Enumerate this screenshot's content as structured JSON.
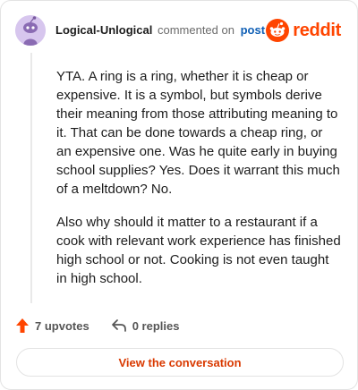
{
  "header": {
    "username": "Logical-Unlogical",
    "verb": "commented on",
    "post_link": "post",
    "brand": "reddit",
    "brand_color": "#ff4500",
    "avatar_icon": "snoo-avatar-icon"
  },
  "comment": {
    "paragraphs": [
      "YTA. A ring is a ring, whether it is cheap or expensive. It is a symbol, but symbols derive their meaning from those attributing meaning to it. That can be done towards a cheap ring, or an expensive one. Was he quite early in buying school supplies? Yes. Does it warrant this much of a meltdown? No.",
      "Also why should it matter to a restaurant if a cook with relevant work experience has finished high school or not. Cooking is not even taught in high school."
    ]
  },
  "actions": {
    "upvotes": "7 upvotes",
    "replies": "0 replies",
    "upvote_icon": "upvote-arrow-icon",
    "reply_icon": "reply-arrow-icon"
  },
  "footer": {
    "view_conversation": "View the conversation",
    "accent_color": "#d93900"
  }
}
